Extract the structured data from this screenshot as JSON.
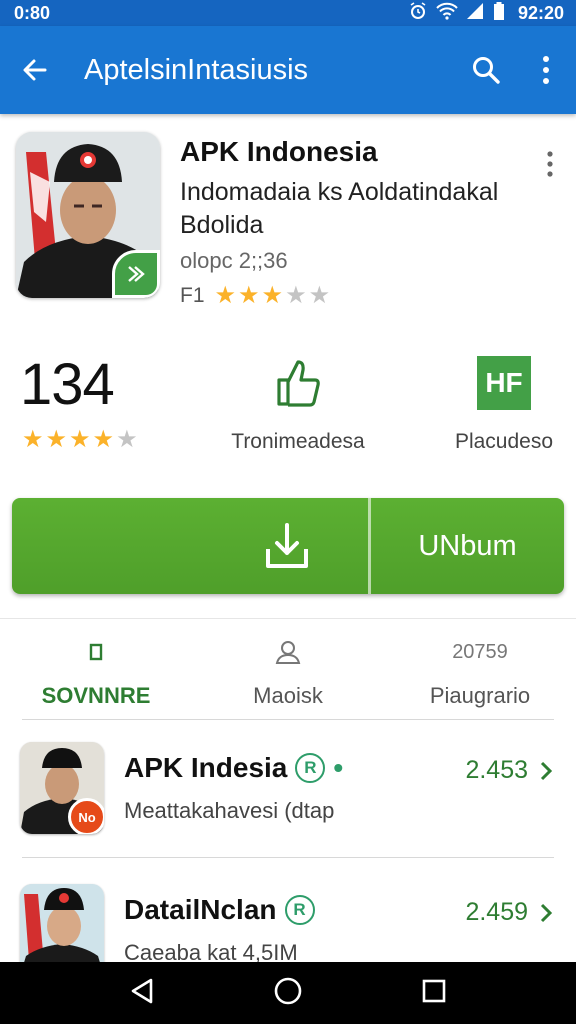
{
  "status_bar": {
    "time_left": "0:80",
    "time_right": "92:20"
  },
  "app_bar": {
    "title": "AptelsinIntasiusis"
  },
  "app": {
    "name": "APK Indonesia",
    "developer_line1": "Indomadaia ks Aoldatindakal",
    "developer_line2": "Bdolida",
    "version": "olopc 2;;36",
    "rating_label": "F1",
    "rating_stars": 3
  },
  "stats": {
    "count": "134",
    "count_stars": 4,
    "middle_label": "Tronimeadesa",
    "right_label": "Placudeso",
    "right_icon_text": "HF"
  },
  "actions": {
    "open_label": "UNbum"
  },
  "tabs": [
    {
      "label": "SOVNNRE",
      "icon": "square-icon",
      "top_text": "",
      "active": true
    },
    {
      "label": "Maoisk",
      "icon": "user-icon",
      "top_text": "",
      "active": false
    },
    {
      "label": "Piaugrario",
      "icon": "",
      "top_text": "20759",
      "active": false
    }
  ],
  "list": [
    {
      "title": "APK Indesia",
      "subtitle": "Meattakahavesi (dtap",
      "score": "2.453",
      "badge_text": "No"
    },
    {
      "title": "DatailNclan",
      "subtitle": "Caeaba kat 4,5IM",
      "score": "2.459",
      "badge_text": ""
    }
  ],
  "colors": {
    "app_bar": "#1976d2",
    "status_bar": "#1565c0",
    "accent_green": "#4f9f2a",
    "star": "#fbb22a"
  }
}
